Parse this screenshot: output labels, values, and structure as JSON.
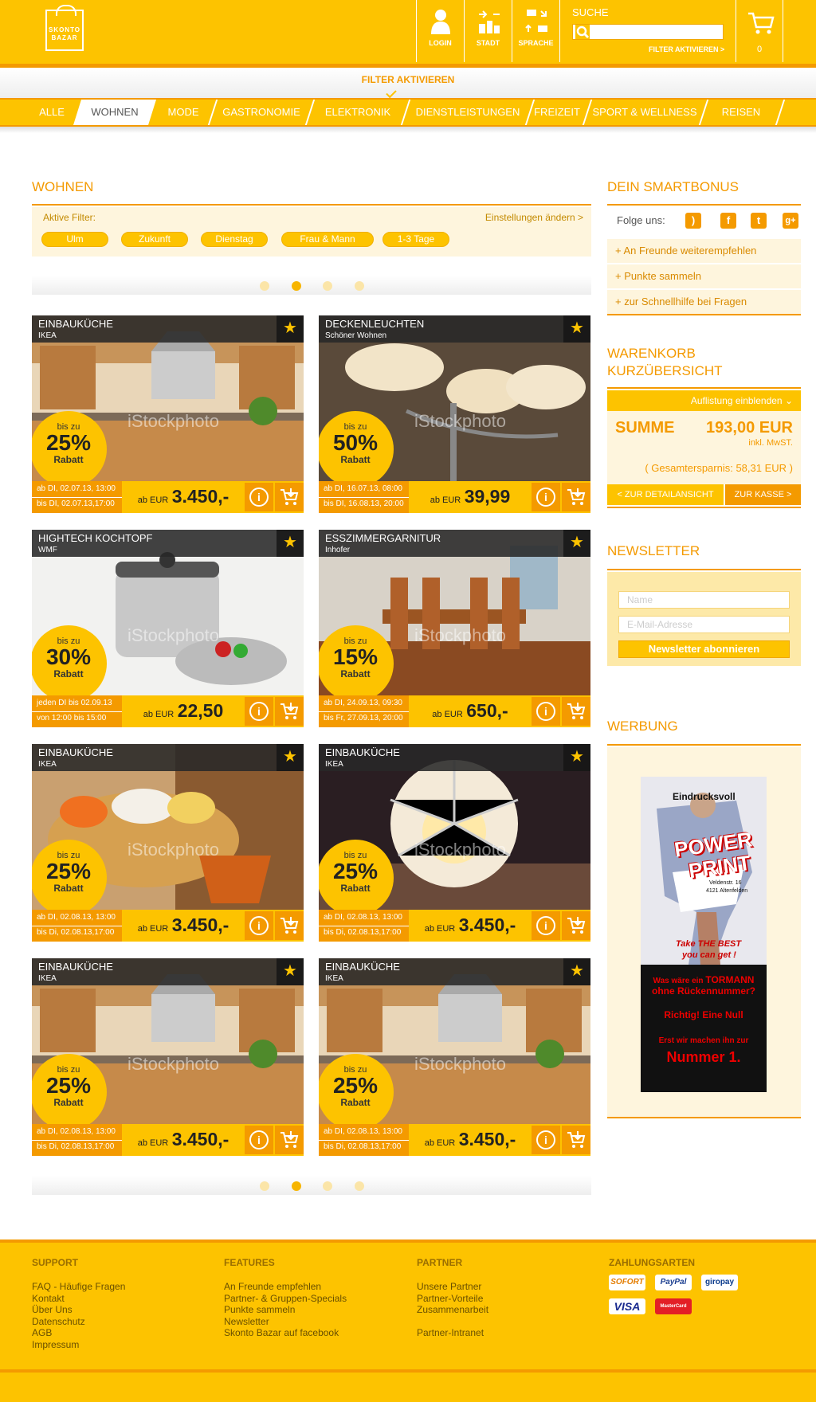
{
  "header": {
    "logo": [
      "SKONTO",
      "BAZAR"
    ],
    "login": "LOGIN",
    "stadt": "STADT",
    "sprache": "SPRACHE",
    "search_label": "SUCHE",
    "search_placeholder": "",
    "filter_link": "FILTER AKTIVIEREN >",
    "cart_count": "0"
  },
  "filter_bar": "FILTER AKTIVIEREN",
  "nav": [
    "ALLE",
    "WOHNEN",
    "MODE",
    "GASTRONOMIE",
    "ELEKTRONIK",
    "DIENSTLEISTUNGEN",
    "FREIZEIT",
    "SPORT & WELLNESS",
    "REISEN"
  ],
  "nav_active": "WOHNEN",
  "main": {
    "title": "WOHNEN",
    "filters_label": "Aktive Filter:",
    "filters_change": "Einstellungen ändern >",
    "chips": [
      "Ulm",
      "Zukunft",
      "Dienstag",
      "Frau & Mann",
      "1-3 Tage"
    ]
  },
  "cards": [
    {
      "t1": "EINBAUKÜCHE",
      "t2": "IKEA",
      "b1": "bis zu",
      "b2": "25%",
      "b3": "Rabatt",
      "d1": "ab DI, 02.07.13, 13:00",
      "d2": "bis DI, 02.07.13,17:00",
      "p1": "ab EUR",
      "p2": "3.450,-",
      "img": "kitchen"
    },
    {
      "t1": "DECKENLEUCHTEN",
      "t2": "Schöner Wohnen",
      "b1": "bis zu",
      "b2": "50%",
      "b3": "Rabatt",
      "d1": "ab DI, 16.07.13, 08:00",
      "d2": "bis DI, 16.08.13, 20:00",
      "p1": "ab EUR",
      "p2": "39,99",
      "img": "lamp"
    },
    {
      "t1": "HIGHTECH KOCHTOPF",
      "t2": "WMF",
      "b1": "bis zu",
      "b2": "30%",
      "b3": "Rabatt",
      "d1": "jeden DI bis 02.09.13",
      "d2": "von 12:00 bis 15:00",
      "p1": "ab EUR",
      "p2": "22,50",
      "img": "pot"
    },
    {
      "t1": "ESSZIMMERGARNITUR",
      "t2": "Inhofer",
      "b1": "bis zu",
      "b2": "15%",
      "b3": "Rabatt",
      "d1": "ab DI, 24.09.13, 09:30",
      "d2": "bis Fr, 27.09.13, 20:00",
      "p1": "ab EUR",
      "p2": "650,-",
      "img": "dining"
    },
    {
      "t1": "EINBAUKÜCHE",
      "t2": "IKEA",
      "b1": "bis zu",
      "b2": "25%",
      "b3": "Rabatt",
      "d1": "ab DI, 02.08.13, 13:00",
      "d2": "bis Di, 02.08.13,17:00",
      "p1": "ab EUR",
      "p2": "3.450,-",
      "img": "sofa"
    },
    {
      "t1": "EINBAUKÜCHE",
      "t2": "IKEA",
      "b1": "bis zu",
      "b2": "25%",
      "b3": "Rabatt",
      "d1": "ab DI, 02.08.13, 13:00",
      "d2": "bis Di, 02.08.13,17:00",
      "p1": "ab EUR",
      "p2": "3.450,-",
      "img": "pendant"
    },
    {
      "t1": "EINBAUKÜCHE",
      "t2": "IKEA",
      "b1": "bis zu",
      "b2": "25%",
      "b3": "Rabatt",
      "d1": "ab DI, 02.08.13, 13:00",
      "d2": "bis Di, 02.08.13,17:00",
      "p1": "ab EUR",
      "p2": "3.450,-",
      "img": "kitchen"
    },
    {
      "t1": "EINBAUKÜCHE",
      "t2": "IKEA",
      "b1": "bis zu",
      "b2": "25%",
      "b3": "Rabatt",
      "d1": "ab DI, 02.08.13, 13:00",
      "d2": "bis Di, 02.08.13,17:00",
      "p1": "ab EUR",
      "p2": "3.450,-",
      "img": "kitchen"
    }
  ],
  "watermark": "iStockphoto",
  "pager": {
    "pages": 4,
    "active": 2
  },
  "sidebar": {
    "smartbonus_title": "DEIN SMARTBONUS",
    "follow_label": "Folge uns:",
    "links": [
      "+ An Freunde weiterempfehlen",
      "+ Punkte sammeln",
      "+ zur Schnellhilfe bei Fragen"
    ],
    "cart_title": "WARENKORB KURZÜBERSICHT",
    "cart_toggle": "Auflistung einblenden",
    "sum_label": "SUMME",
    "sum_value": "193,00 EUR",
    "mwst": "inkl. MwST.",
    "savings": "( Gesamtersparnis: 58,31 EUR )",
    "detail_btn": "< ZUR DETAILANSICHT",
    "checkout_btn": "ZUR KASSE >",
    "newsletter_title": "NEWSLETTER",
    "name_placeholder": "Name",
    "email_placeholder": "E-Mail-Adresse",
    "subscribe": "Newsletter abonnieren",
    "ad_title": "WERBUNG",
    "ad": {
      "eindrucksvoll": "Eindrucksvoll",
      "power": "POWER",
      "print": "PRINT",
      "addr1": "Veldenstr. 16",
      "addr2": "4121 Altenfelden",
      "take": "Take THE BEST",
      "can": "you can get !",
      "q1": "Was wäre ein",
      "q1b": "TORMANN",
      "q2": "ohne Rückennummer?",
      "q3": "Richtig! Eine Null",
      "q4": "Erst wir machen ihn zur",
      "q5": "Nummer 1."
    }
  },
  "footer": {
    "support": {
      "title": "SUPPORT",
      "items": [
        "FAQ - Häufige Fragen",
        "Kontakt",
        "Über Uns",
        "Datenschutz",
        "AGB",
        "Impressum"
      ]
    },
    "features": {
      "title": "FEATURES",
      "items": [
        "An Freunde empfehlen",
        "Partner- & Gruppen-Specials",
        "Punkte sammeln",
        "Newsletter",
        "Skonto Bazar auf facebook"
      ]
    },
    "partner": {
      "title": "PARTNER",
      "items": [
        "Unsere Partner",
        "Partner-Vorteile",
        "Zusammenarbeit",
        "",
        "Partner-Intranet"
      ]
    },
    "payment": {
      "title": "ZAHLUNGSARTEN",
      "methods": [
        "SOFORT",
        "PayPal",
        "giropay",
        "VISA",
        "MasterCard"
      ]
    }
  },
  "colors": {
    "accent": "#fdc300",
    "accent_dark": "#f49a00"
  }
}
